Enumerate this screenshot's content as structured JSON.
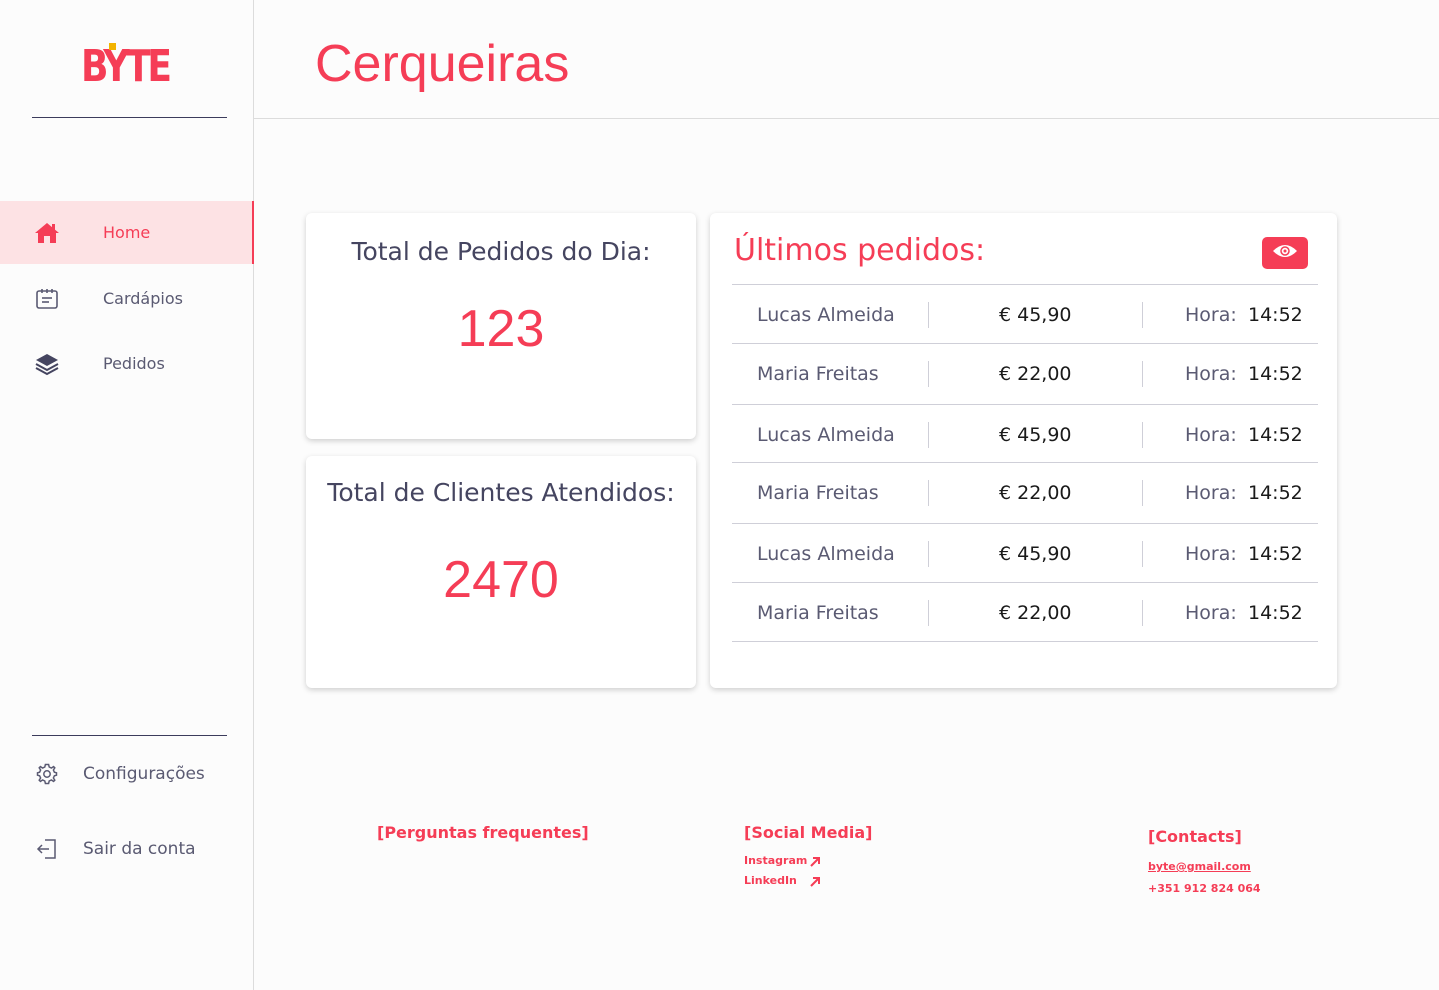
{
  "brand": {
    "logo_text": "BYTE",
    "accent": "#f53d56",
    "dot_color": "#f3b400"
  },
  "header": {
    "title": "Cerqueiras"
  },
  "sidebar": {
    "items": [
      {
        "label": "Home",
        "icon": "home-icon",
        "active": true
      },
      {
        "label": "Cardápios",
        "icon": "menu-card-icon",
        "active": false
      },
      {
        "label": "Pedidos",
        "icon": "layers-icon",
        "active": false
      }
    ],
    "bottom": [
      {
        "label": "Configurações",
        "icon": "gear-icon"
      },
      {
        "label": "Sair da conta",
        "icon": "logout-icon"
      }
    ]
  },
  "stats": {
    "orders": {
      "title": "Total de Pedidos do Dia:",
      "value": "123"
    },
    "clients": {
      "title": "Total de Clientes Atendidos:",
      "value": "2470"
    }
  },
  "recent_orders": {
    "title": "Últimos pedidos:",
    "view_icon": "eye-icon",
    "hora_label": "Hora:",
    "rows": [
      {
        "name": "Lucas Almeida",
        "price": "€ 45,90",
        "time": "14:52"
      },
      {
        "name": "Maria Freitas",
        "price": "€ 22,00",
        "time": "14:52"
      },
      {
        "name": "Lucas Almeida",
        "price": "€ 45,90",
        "time": "14:52"
      },
      {
        "name": "Maria Freitas",
        "price": "€ 22,00",
        "time": "14:52"
      },
      {
        "name": "Lucas Almeida",
        "price": "€ 45,90",
        "time": "14:52"
      },
      {
        "name": "Maria Freitas",
        "price": "€ 22,00",
        "time": "14:52"
      }
    ]
  },
  "footer": {
    "faq": "[Perguntas frequentes]",
    "social": {
      "title": "[Social Media]",
      "links": [
        "Instagram",
        "LinkedIn"
      ]
    },
    "contacts": {
      "title": "[Contacts]",
      "email": "byte@gmail.com",
      "phone": "+351 912 824 064"
    }
  }
}
